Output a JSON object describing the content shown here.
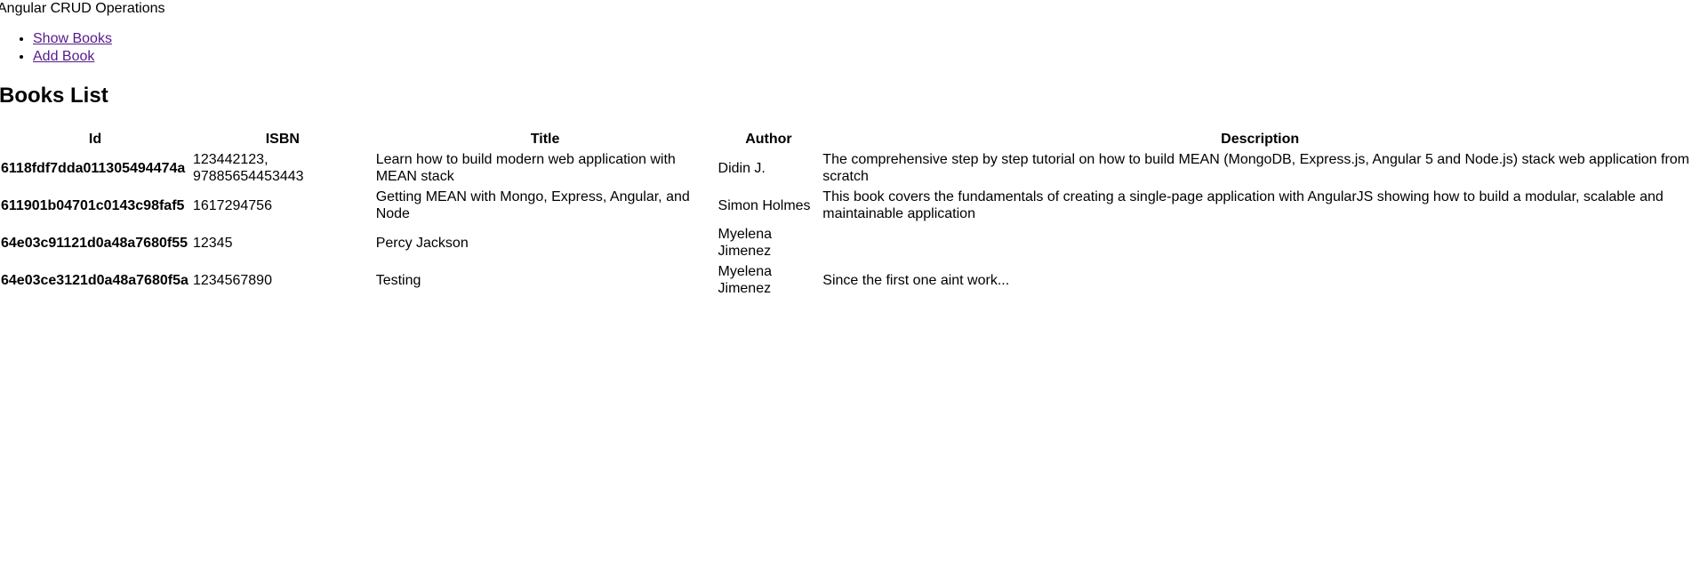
{
  "app": {
    "title": "Angular CRUD Operations"
  },
  "nav": {
    "items": [
      {
        "label": "Show Books"
      },
      {
        "label": "Add Book"
      }
    ]
  },
  "books_list": {
    "heading": "Books List",
    "columns": [
      "Id",
      "ISBN",
      "Title",
      "Author",
      "Description"
    ],
    "rows": [
      {
        "id": "6118fdf7dda011305494474a",
        "isbn": "123442123, 97885654453443",
        "title": "Learn how to build modern web application with MEAN stack",
        "author": "Didin J.",
        "description": "The comprehensive step by step tutorial on how to build MEAN (MongoDB, Express.js, Angular 5 and Node.js) stack web application from scratch"
      },
      {
        "id": "611901b04701c0143c98faf5",
        "isbn": "1617294756",
        "title": "Getting MEAN with Mongo, Express, Angular, and Node",
        "author": "Simon Holmes",
        "description": "This book covers the fundamentals of creating a single-page application with AngularJS showing how to build a modular, scalable and maintainable application"
      },
      {
        "id": "64e03c91121d0a48a7680f55",
        "isbn": "12345",
        "title": "Percy Jackson",
        "author": "Myelena Jimenez",
        "description": ""
      },
      {
        "id": "64e03ce3121d0a48a7680f5a",
        "isbn": "1234567890",
        "title": "Testing",
        "author": "Myelena Jimenez",
        "description": "Since the first one aint work..."
      }
    ]
  },
  "colors": {
    "link_visited": "#551a8b",
    "text": "#000000",
    "background": "#ffffff"
  }
}
